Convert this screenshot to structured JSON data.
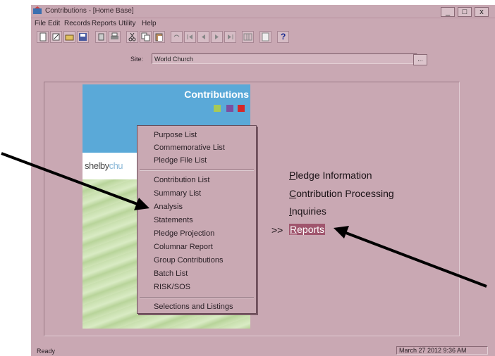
{
  "window": {
    "title": "Contributions - [Home Base]",
    "minimize": "_",
    "maximize": "□",
    "close": "x"
  },
  "menu": {
    "items": [
      "File",
      "Edit",
      "Records",
      "Reports",
      "Utility",
      "Help"
    ]
  },
  "toolbar": {
    "help_icon": "?"
  },
  "site": {
    "label": "Site:",
    "value": "World Church",
    "browse": "..."
  },
  "splash": {
    "title": "Contributions",
    "brand_dark": "shelby",
    "brand_light": "chu",
    "squares": [
      "#a7c957",
      "#7b4fa0",
      "#d62828"
    ]
  },
  "popup_menu": {
    "groups": [
      [
        "Purpose List",
        "Commemorative List",
        "Pledge File List"
      ],
      [
        "Contribution List",
        "Summary List",
        "Analysis",
        "Statements",
        "Pledge Projection",
        "Columnar Report",
        "Group Contributions",
        "Batch List",
        "RISK/SOS"
      ],
      [
        "Selections and Listings"
      ]
    ]
  },
  "nav": {
    "marker": ">>",
    "items": [
      {
        "first": "P",
        "rest": "ledge Information"
      },
      {
        "first": "C",
        "rest": "ontribution Processing"
      },
      {
        "first": "I",
        "rest": "nquiries"
      },
      {
        "first": "R",
        "rest": "eports"
      }
    ]
  },
  "status": {
    "text": "Ready",
    "datetime": "March 27 2012 9:36 AM"
  },
  "colors": {
    "window_bg": "#c9a8b3",
    "accent": "#a0566e",
    "annotation_arrow": "#000000"
  }
}
